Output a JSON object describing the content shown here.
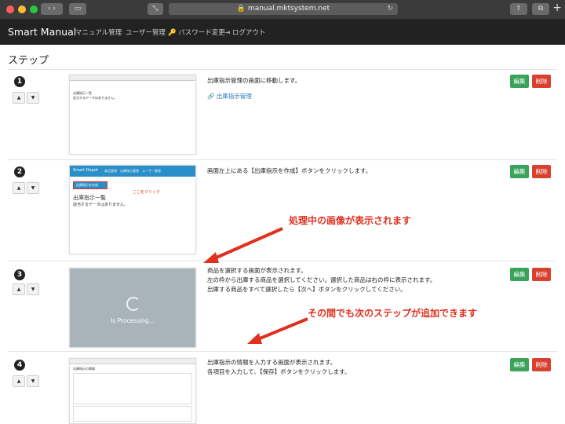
{
  "browser": {
    "url": "manual.mktsystem.net",
    "colors": {
      "close": "#ff5f57",
      "min": "#febc2e",
      "max": "#28c840"
    }
  },
  "nav": {
    "brand": "Smart Manual",
    "links": [
      "マニュアル管理",
      "ユーザー管理",
      "パスワード変更",
      "ログアウト"
    ]
  },
  "page": {
    "title": "ステップ"
  },
  "buttons": {
    "edit": "編集",
    "delete": "削除"
  },
  "steps": [
    {
      "num": "1",
      "lines": [
        "出庫指示管理の画面に移動します。"
      ],
      "link": "出庫指示管理",
      "thumb": {
        "nav": "",
        "heading": "出庫指示一覧",
        "sub": "該当するデータはありません。"
      }
    },
    {
      "num": "2",
      "lines": [
        "画面左上にある【出庫指示を作成】ボタンをクリックします。"
      ],
      "thumb": {
        "nav": "Smart Depot",
        "menu": "商品管理　出庫指示管理　ユーザー管理",
        "button": "出庫指示を作成",
        "callout": "ここをクリック",
        "heading": "出庫指示一覧",
        "sub": "該当するデータはありません。"
      }
    },
    {
      "num": "3",
      "lines": [
        "商品を選択する画面が表示されます。",
        "左の枠から出庫する商品を選択してください。選択した商品は右の枠に表示されます。",
        "出庫する商品をすべて選択したら【次へ】ボタンをクリックしてください。"
      ],
      "thumb": {
        "processing": "Is Processing..."
      }
    },
    {
      "num": "4",
      "lines": [
        "出庫指示の情報を入力する画面が表示されます。",
        "各項目を入力して、【保存】ボタンをクリックします。"
      ],
      "thumb": {
        "heading": "出庫指示の情報"
      }
    }
  ],
  "annotations": {
    "top": "処理中の画像が表示されます",
    "bottom": "その間でも次のステップが追加できます"
  }
}
